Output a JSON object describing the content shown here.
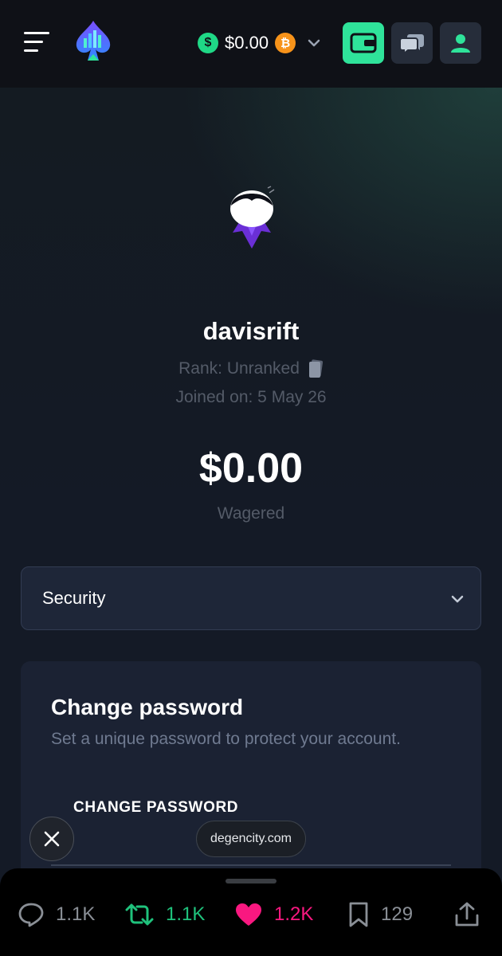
{
  "header": {
    "menu_icon": "hamburger-menu-icon",
    "logo_icon": "spade-city-logo-icon",
    "balance": "$0.00",
    "currency_icon": "usd-coin-icon",
    "crypto_icon": "bitcoin-icon",
    "dropdown_icon": "chevron-down-icon",
    "wallet_icon": "wallet-icon",
    "chat_icon": "chat-bubbles-icon",
    "profile_icon": "user-icon",
    "accent_color": "#2fe39a"
  },
  "profile": {
    "username": "davisrift",
    "rank": "Rank: Unranked",
    "rank_icon": "card-stack-icon",
    "joined": "Joined on: 5 May 26",
    "wagered_amount": "$0.00",
    "wagered_label": "Wagered"
  },
  "section_select": {
    "selected": "Security"
  },
  "change_password_card": {
    "title": "Change password",
    "subtitle": "Set a unique password to protect your account.",
    "field_label": "CHANGE PASSWORD"
  },
  "browser_overlay": {
    "close_icon": "close-icon",
    "domain": "degencity.com"
  },
  "post_actions": {
    "replies": "1.1K",
    "reposts": "1.1K",
    "likes": "1.2K",
    "bookmarks": "129",
    "like_color": "#f91880",
    "repost_color": "#1fc27c"
  }
}
